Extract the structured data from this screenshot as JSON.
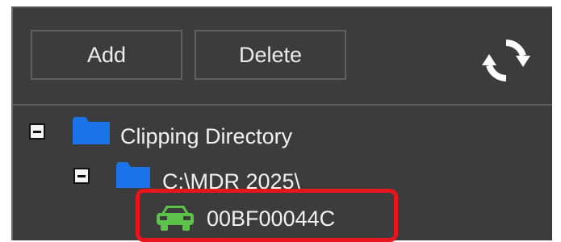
{
  "toolbar": {
    "add_label": "Add",
    "delete_label": "Delete",
    "refresh_icon": "refresh-icon"
  },
  "tree": {
    "root": {
      "label": "Clipping Directory",
      "expanded": true,
      "icon": "folder-icon",
      "icon_color": "#1a73e8"
    },
    "child": {
      "label": "C:\\MDR 2025\\",
      "expanded": true,
      "icon": "folder-icon",
      "icon_color": "#1a73e8"
    },
    "leaf": {
      "label": "00BF00044C",
      "icon": "car-icon",
      "icon_color": "#5cc24a",
      "highlighted": true
    }
  },
  "colors": {
    "panel_bg": "#3c3c3c",
    "highlight_border": "#e8161c"
  }
}
